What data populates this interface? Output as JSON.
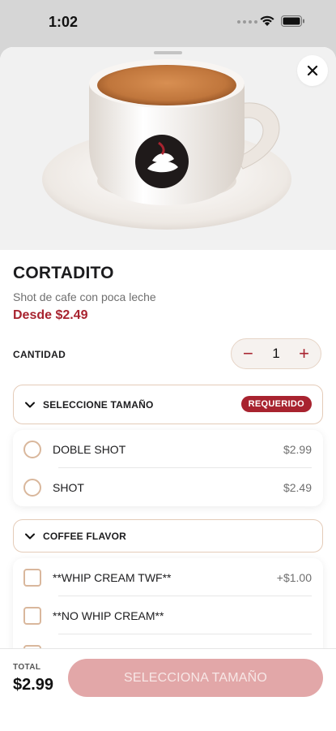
{
  "status_bar": {
    "time": "1:02"
  },
  "product": {
    "title": "CORTADITO",
    "description": "Shot de cafe con poca leche",
    "price_from": "Desde $2.49"
  },
  "quantity": {
    "label": "CANTIDAD",
    "value": "1",
    "minus": "−",
    "plus": "+"
  },
  "size_group": {
    "title": "SELECCIONE TAMAÑO",
    "badge": "REQUERIDO",
    "options": [
      {
        "label": "DOBLE SHOT",
        "price": "$2.99"
      },
      {
        "label": "SHOT",
        "price": "$2.49"
      }
    ]
  },
  "flavor_group": {
    "title": "COFFEE FLAVOR",
    "options": [
      {
        "label": "**WHIP CREAM TWF**",
        "price": "+$1.00"
      },
      {
        "label": "**NO WHIP CREAM**",
        "price": ""
      }
    ]
  },
  "footer": {
    "total_label": "TOTAL",
    "total_value": "$2.99",
    "cta": "SELECCIONA TAMAÑO"
  },
  "colors": {
    "accent": "#a8232f",
    "cta_disabled": "#e2a7a8",
    "border": "#e4cbb8"
  }
}
